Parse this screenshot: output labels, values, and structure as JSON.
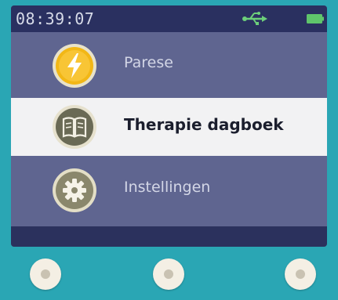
{
  "status": {
    "time": "08:39:07",
    "usb_icon": "usb-icon",
    "battery_icon": "battery-icon",
    "battery_color": "#5fc56b"
  },
  "menu": {
    "items": [
      {
        "label": "Parese",
        "icon": "lightning-icon",
        "selected": false
      },
      {
        "label": "Therapie dagboek",
        "icon": "book-icon",
        "selected": true
      },
      {
        "label": "Instellingen",
        "icon": "gear-icon",
        "selected": false
      }
    ]
  },
  "hardware_buttons": [
    "left-button",
    "middle-button",
    "right-button"
  ]
}
